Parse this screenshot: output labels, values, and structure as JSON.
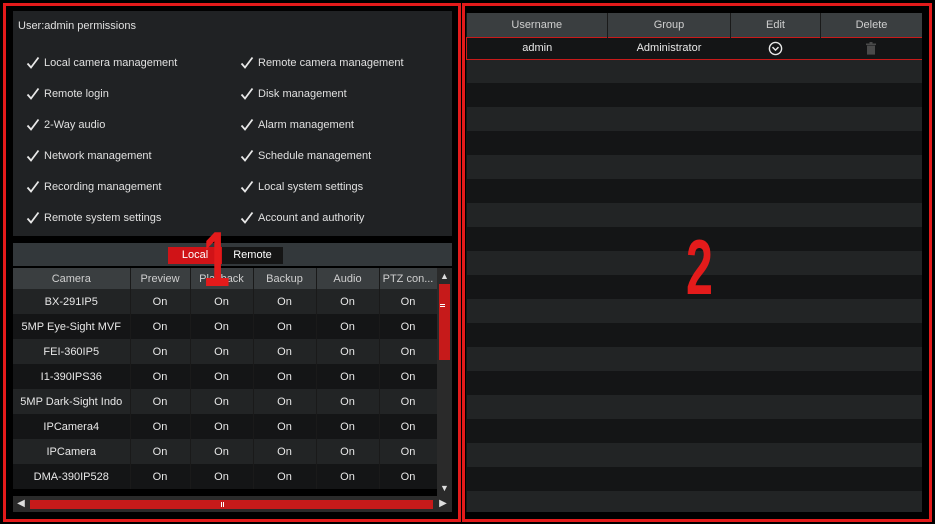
{
  "permissions": {
    "title": "User:admin permissions",
    "left": [
      "Local camera management",
      "Remote login",
      "2-Way audio",
      "Network management",
      "Recording management",
      "Remote system settings"
    ],
    "right": [
      "Remote camera management",
      "Disk management",
      "Alarm management",
      "Schedule management",
      "Local system settings",
      "Account and authority"
    ]
  },
  "tabs": {
    "local": "Local",
    "remote": "Remote"
  },
  "camera_table": {
    "headers": [
      "Camera",
      "Preview",
      "Playback",
      "Backup",
      "Audio",
      "PTZ con..."
    ],
    "rows": [
      [
        "BX-291IP5",
        "On",
        "On",
        "On",
        "On",
        "On"
      ],
      [
        "5MP Eye-Sight MVF",
        "On",
        "On",
        "On",
        "On",
        "On"
      ],
      [
        "FEI-360IP5",
        "On",
        "On",
        "On",
        "On",
        "On"
      ],
      [
        "I1-390IPS36",
        "On",
        "On",
        "On",
        "On",
        "On"
      ],
      [
        "5MP Dark-Sight Indo",
        "On",
        "On",
        "On",
        "On",
        "On"
      ],
      [
        "IPCamera4",
        "On",
        "On",
        "On",
        "On",
        "On"
      ],
      [
        "IPCamera",
        "On",
        "On",
        "On",
        "On",
        "On"
      ],
      [
        "DMA-390IP528",
        "On",
        "On",
        "On",
        "On",
        "On"
      ]
    ]
  },
  "callouts": {
    "one": "1",
    "two": "2"
  },
  "users_table": {
    "headers": [
      "Username",
      "Group",
      "Edit",
      "Delete"
    ],
    "rows": [
      {
        "username": "admin",
        "group": "Administrator",
        "edit_icon": "edit-circle-chevron-icon",
        "delete_icon": "trash-icon"
      }
    ]
  },
  "colors": {
    "accent": "#e41b1b",
    "tab_active": "#d01317",
    "row_odd": "#222425",
    "row_even": "#141516",
    "header": "#3a3e40"
  }
}
